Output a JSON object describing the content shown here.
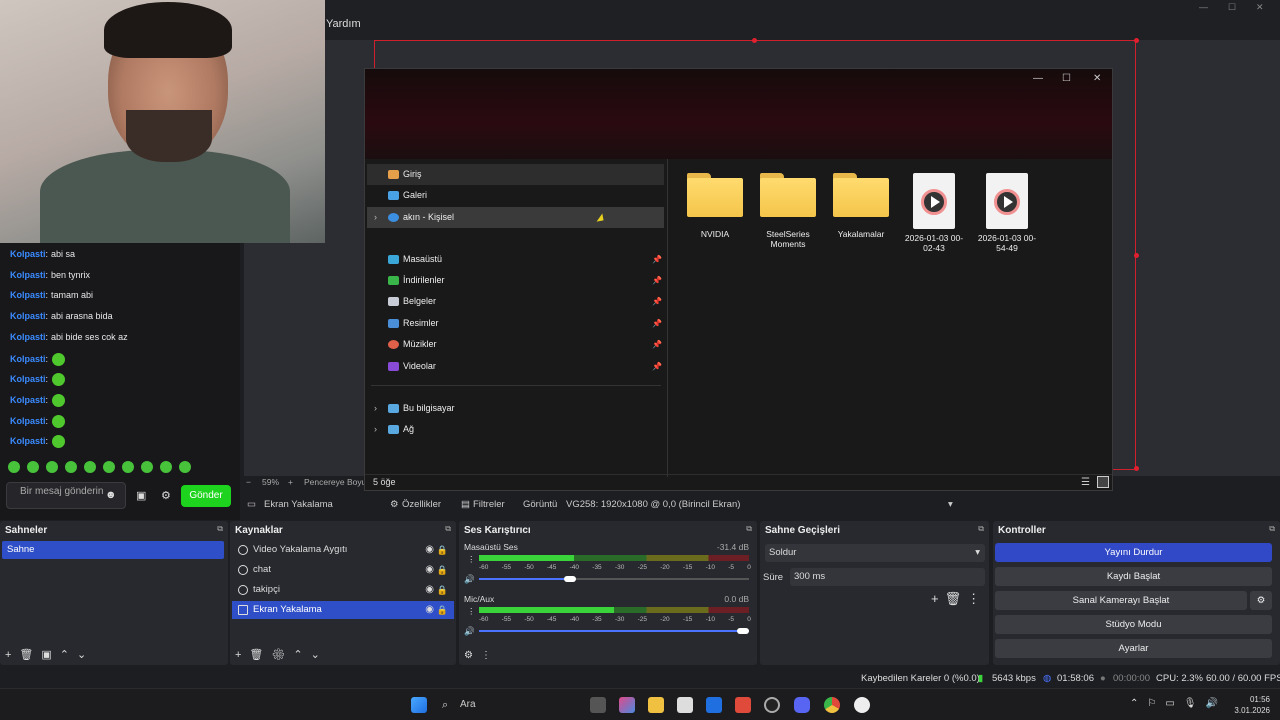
{
  "window": {
    "menu_help": "Yardım"
  },
  "chat": {
    "messages": [
      {
        "user": "Kolpasti",
        "text": "abi sa"
      },
      {
        "user": "Kolpasti",
        "text": "ben tynrix"
      },
      {
        "user": "Kolpasti",
        "text": "tamam abi"
      },
      {
        "user": "Kolpasti",
        "text": "abi arasna bida"
      },
      {
        "user": "Kolpasti",
        "text": "abi bide ses cok az"
      },
      {
        "user": "Kolpasti",
        "text": ""
      },
      {
        "user": "Kolpasti",
        "text": ""
      },
      {
        "user": "Kolpasti",
        "text": ""
      },
      {
        "user": "Kolpasti",
        "text": ""
      },
      {
        "user": "Kolpasti",
        "text": ""
      }
    ],
    "input_placeholder": "Bir mesaj gönderin",
    "send_label": "Gönder"
  },
  "explorer": {
    "nav": {
      "home": "Giriş",
      "gallery": "Galeri",
      "personal": "akın - Kişisel",
      "desktop": "Masaüstü",
      "downloads": "İndirilenler",
      "documents": "Belgeler",
      "pictures": "Resimler",
      "music": "Müzikler",
      "videos": "Videolar",
      "this_pc": "Bu bilgisayar",
      "network": "Ağ"
    },
    "files": [
      {
        "name": "NVIDIA",
        "type": "folder"
      },
      {
        "name": "SteelSeries Moments",
        "type": "folder"
      },
      {
        "name": "Yakalamalar",
        "type": "folder"
      },
      {
        "name": "2026-01-03 00-02-43",
        "type": "video"
      },
      {
        "name": "2026-01-03 00-54-49",
        "type": "video"
      }
    ],
    "item_count": "5 öğe"
  },
  "preview_bar": {
    "zoom": "59%",
    "fit": "Pencereye Boyutl"
  },
  "source_bar": {
    "selected_source": "Ekran Yakalama",
    "properties": "Özellikler",
    "filters": "Filtreler",
    "display_label": "Görüntü",
    "display_value": "VG258: 1920x1080 @ 0,0 (Birincil Ekran)"
  },
  "scenes": {
    "title": "Sahneler",
    "items": [
      "Sahne"
    ]
  },
  "sources": {
    "title": "Kaynaklar",
    "items": [
      "Video Yakalama Aygıtı",
      "chat",
      "takipçi",
      "Ekran Yakalama"
    ]
  },
  "mixer": {
    "title": "Ses Karıştırıcı",
    "channels": [
      {
        "name": "Masaüstü Ses",
        "db": "-31.4 dB",
        "level": 0.35,
        "volume": 0.36
      },
      {
        "name": "Mic/Aux",
        "db": "0.0 dB",
        "level": 0.5,
        "volume": 1.0
      }
    ],
    "scale": [
      "-60",
      "-55",
      "-50",
      "-45",
      "-40",
      "-35",
      "-30",
      "-25",
      "-20",
      "-15",
      "-10",
      "-5",
      "0"
    ]
  },
  "transitions": {
    "title": "Sahne Geçişleri",
    "type": "Soldur",
    "duration_label": "Süre",
    "duration": "300 ms"
  },
  "controls": {
    "title": "Kontroller",
    "stop_stream": "Yayını Durdur",
    "start_record": "Kaydı Başlat",
    "virtual_cam": "Sanal Kamerayı Başlat",
    "studio_mode": "Stüdyo Modu",
    "settings": "Ayarlar"
  },
  "status": {
    "dropped": "Kaybedilen Kareler 0 (%0.0)",
    "bitrate": "5643 kbps",
    "stream_time": "01:58:06",
    "record_time": "00:00:00",
    "cpu": "CPU: 2.3%",
    "fps": "60.00 / 60.00 FPS"
  },
  "taskbar": {
    "search": "Ara",
    "time": "01:56",
    "date": "3.01.2026"
  },
  "colors": {
    "accent": "#3148c7",
    "send": "#1ed31e",
    "chat_name": "#3a8bff",
    "capture_border": "#d0202e"
  }
}
